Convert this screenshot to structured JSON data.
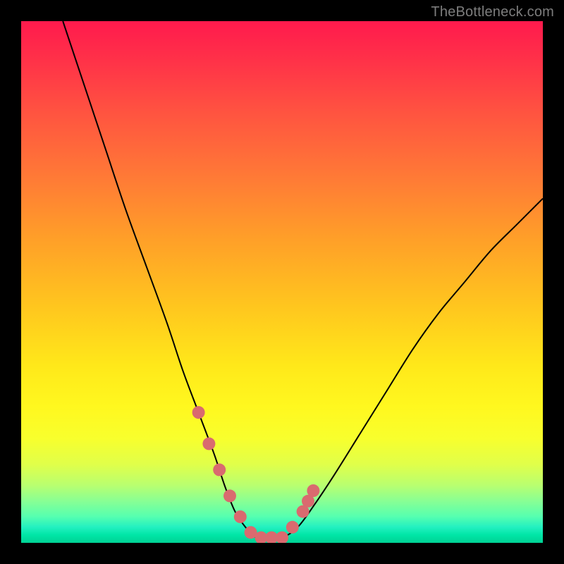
{
  "watermark": "TheBottleneck.com",
  "colors": {
    "background": "#000000",
    "curve_stroke": "#000000",
    "marker_fill": "#d96a6f",
    "gradient_top": "#ff1a4d",
    "gradient_bottom": "#00d194"
  },
  "chart_data": {
    "type": "line",
    "title": "",
    "xlabel": "",
    "ylabel": "",
    "xlim": [
      0,
      100
    ],
    "ylim": [
      0,
      100
    ],
    "annotations": [
      "TheBottleneck.com"
    ],
    "series": [
      {
        "name": "bottleneck-curve",
        "x": [
          8,
          12,
          16,
          20,
          24,
          28,
          31,
          34,
          37,
          39,
          41,
          43,
          45,
          47,
          50,
          53,
          56,
          60,
          65,
          70,
          75,
          80,
          85,
          90,
          95,
          100
        ],
        "y": [
          100,
          88,
          76,
          64,
          53,
          42,
          33,
          25,
          17,
          11,
          6,
          3,
          1,
          1,
          1,
          3,
          7,
          13,
          21,
          29,
          37,
          44,
          50,
          56,
          61,
          66
        ]
      }
    ],
    "markers": {
      "name": "highlight-dots",
      "x": [
        34,
        36,
        38,
        40,
        42,
        44,
        46,
        48,
        50,
        52,
        54,
        55,
        56
      ],
      "y": [
        25,
        19,
        14,
        9,
        5,
        2,
        1,
        1,
        1,
        3,
        6,
        8,
        10
      ]
    }
  }
}
